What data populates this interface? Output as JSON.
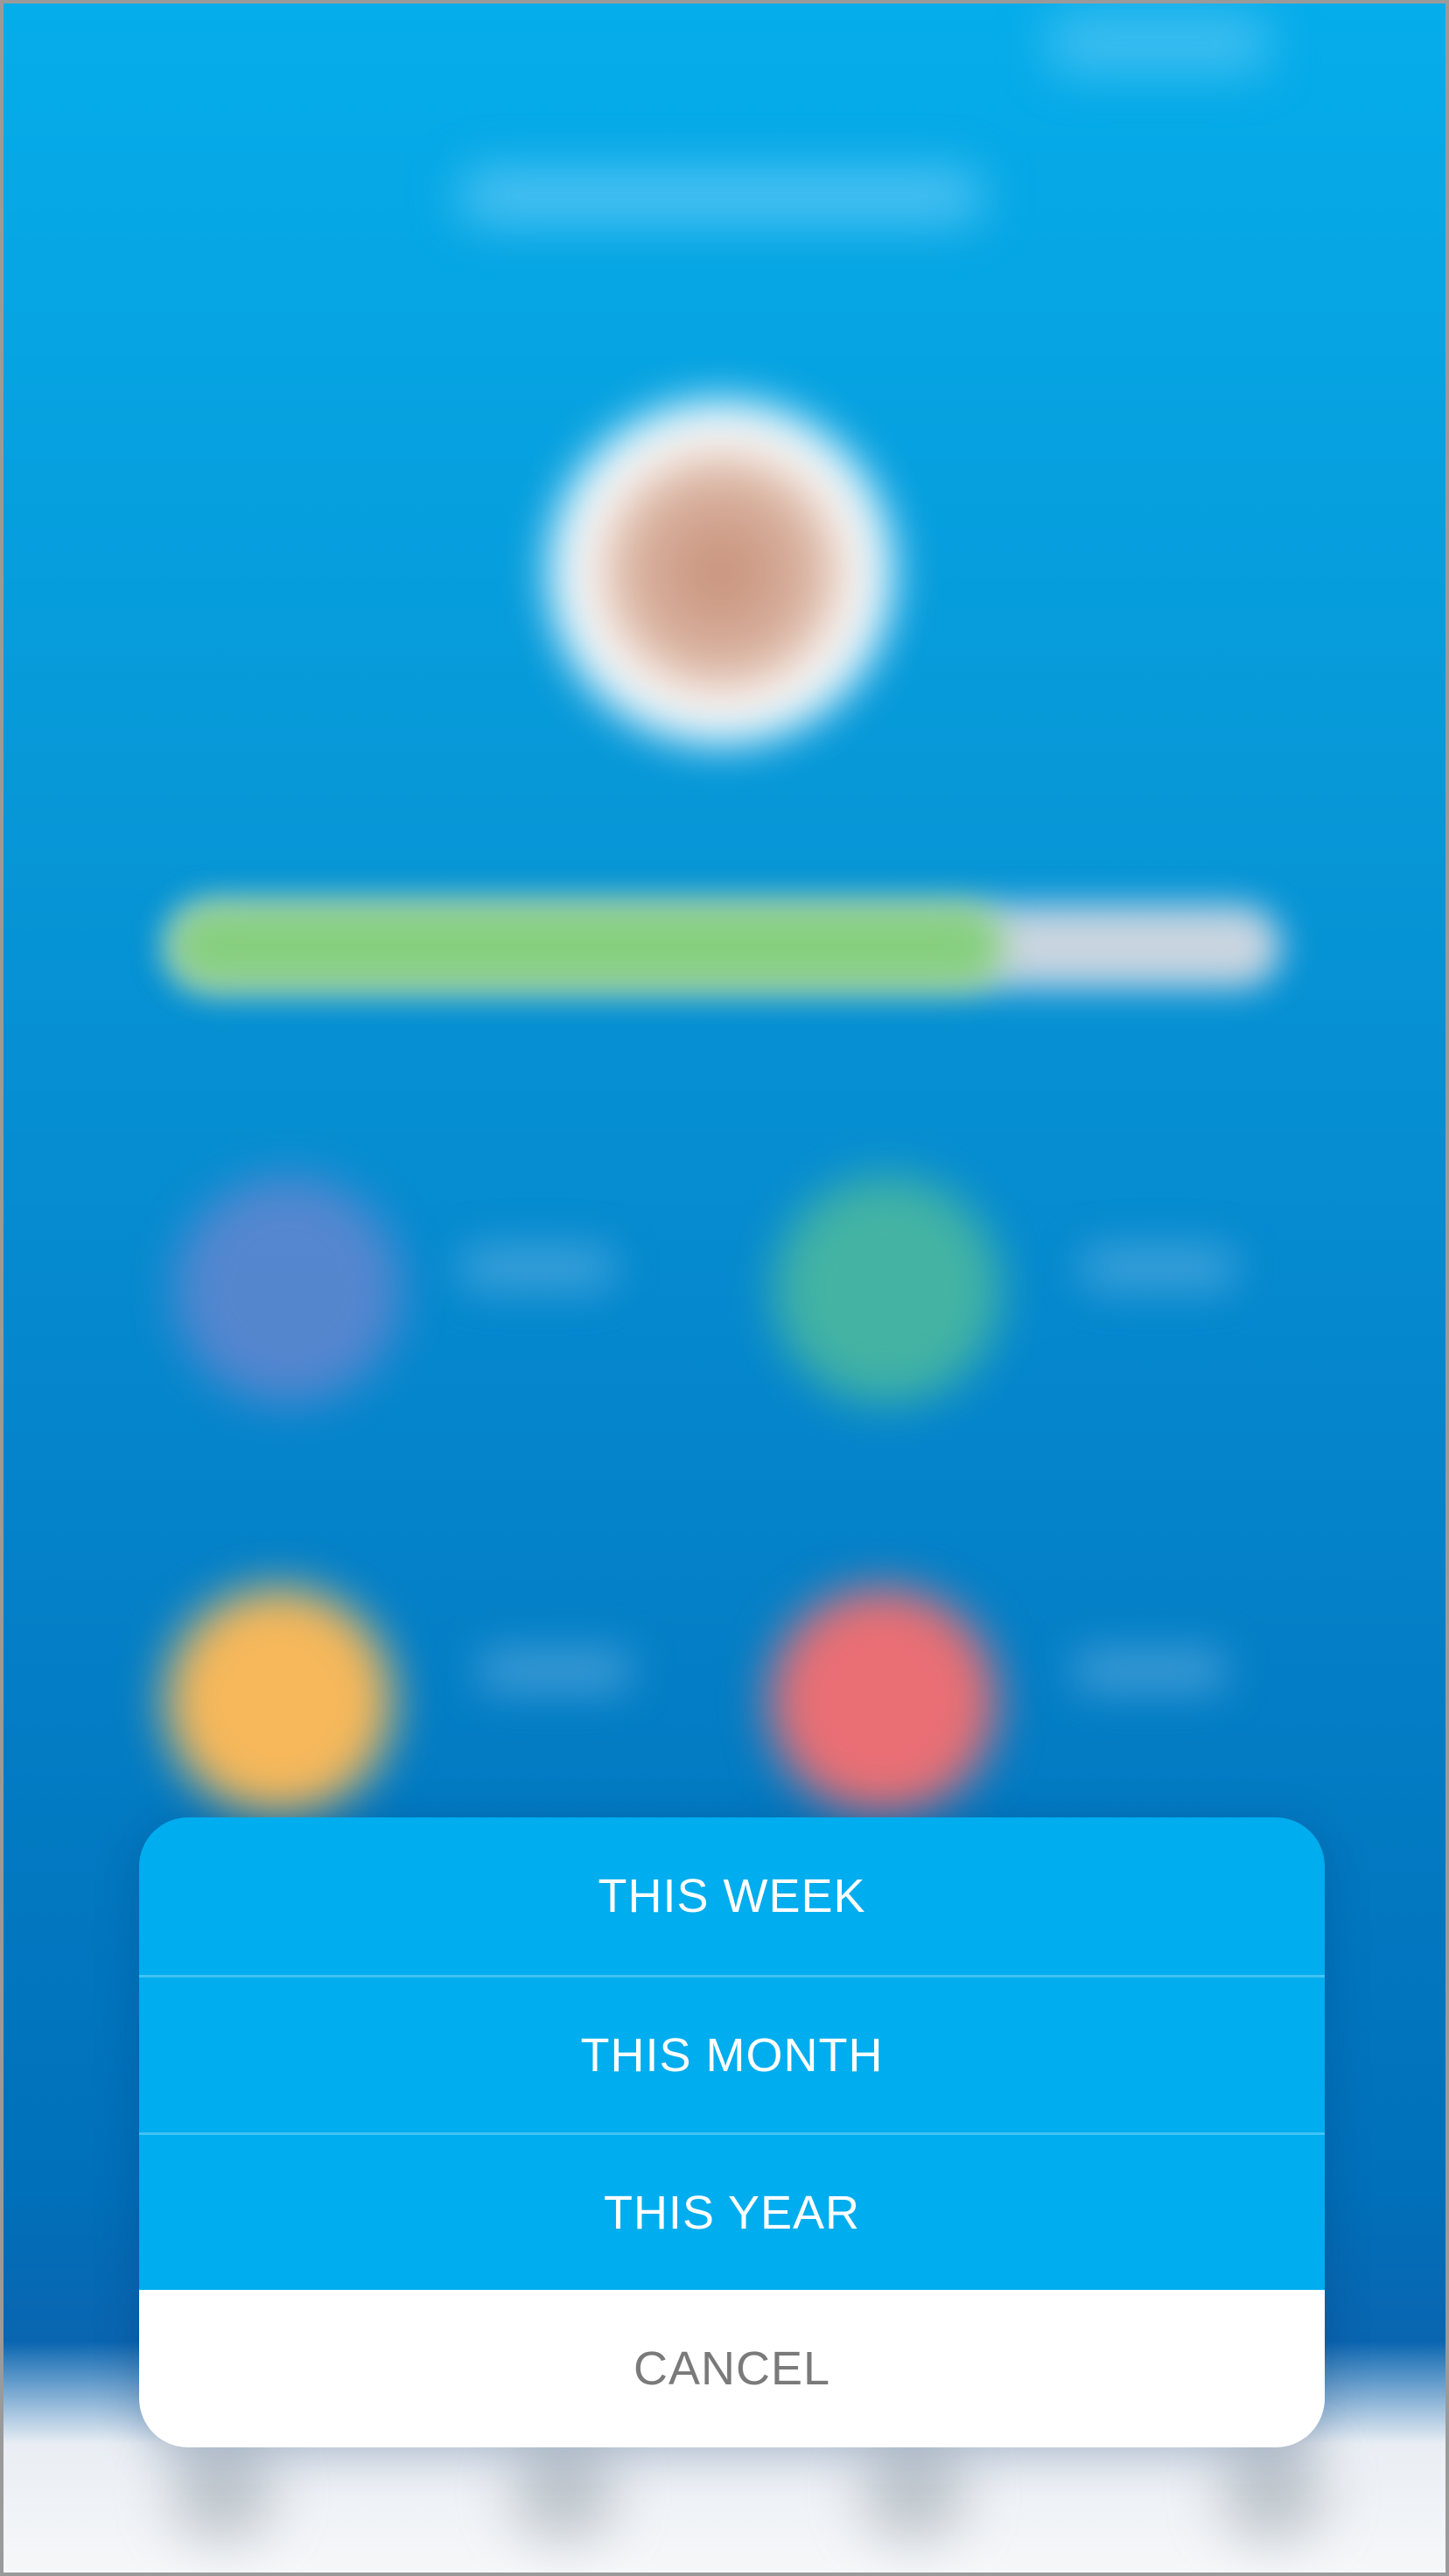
{
  "action_sheet": {
    "options": [
      {
        "label": "THIS WEEK"
      },
      {
        "label": "THIS MONTH"
      },
      {
        "label": "THIS YEAR"
      }
    ],
    "cancel_label": "CANCEL"
  },
  "background": {
    "progress_fraction": 0.75,
    "colors": {
      "sheet_option": "#00adee",
      "sheet_cancel": "#ffffff",
      "stat_purple": "#6f86cf",
      "stat_green": "#4fbb9c",
      "stat_orange": "#f6b85a",
      "stat_red": "#e96f74",
      "progress_fill": "#86cf7f"
    }
  }
}
